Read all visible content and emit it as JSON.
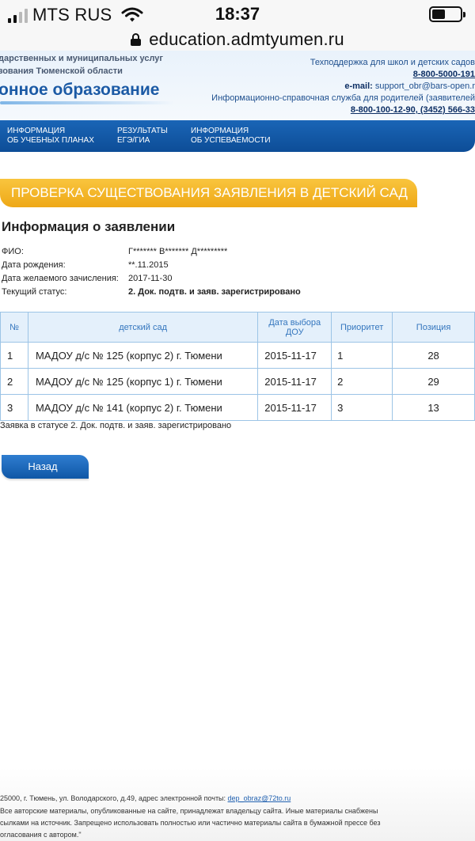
{
  "status_bar": {
    "carrier": "MTS RUS",
    "time": "18:37",
    "battery_level": 0.46
  },
  "browser": {
    "url": "education.admtyumen.ru"
  },
  "header": {
    "org_line1": "дарственных и муниципальных услуг",
    "org_line2": "зования Тюменской области",
    "brand": "онное образование",
    "support_label": "Техподдержка для школ и детских садов",
    "support_phone": "8-800-5000-191",
    "email_label": "e-mail:",
    "email_value": "support_obr@bars-open.r",
    "parents_info": "Информационно-справочная служба для родителей (заявителей",
    "parents_phones": "8-800-100-12-90, (3452) 566-33"
  },
  "nav": {
    "item1_line1": "ИНФОРМАЦИЯ",
    "item1_line2": "ОБ УЧЕБНЫХ ПЛАНАХ",
    "item2_line1": "РЕЗУЛЬТАТЫ",
    "item2_line2": "ЕГЭ/ГИА",
    "item3_line1": "ИНФОРМАЦИЯ",
    "item3_line2": "ОБ УСПЕВАЕМОСТИ"
  },
  "page": {
    "banner_title": "ПРОВЕРКА СУЩЕСТВОВАНИЯ ЗАЯВЛЕНИЯ В ДЕТСКИЙ САД",
    "info_title": "Информация о заявлении",
    "fio_label": "ФИО:",
    "fio_value": "Г******* В******* Д*********",
    "birth_label": "Дата рождения:",
    "birth_value": "**.11.2015",
    "enroll_label": "Дата желаемого зачисления:",
    "enroll_value": "2017-11-30",
    "status_label": "Текущий статус:",
    "status_value": "2. Док. подтв. и заяв. зарегистрировано",
    "status_note": "Заявка в статусе 2. Док. подтв. и заяв. зарегистрировано",
    "back_button": "Назад"
  },
  "table": {
    "headers": {
      "num": "№",
      "kindergarten": "детский сад",
      "date_line1": "Дата выбора",
      "date_line2": "ДОУ",
      "priority": "Приоритет",
      "position": "Позиция"
    },
    "rows": [
      {
        "num": "1",
        "kindergarten": "МАДОУ д/с № 125 (корпус 2) г. Тюмени",
        "date": "2015-11-17",
        "priority": "1",
        "position": "28"
      },
      {
        "num": "2",
        "kindergarten": "МАДОУ д/с № 125 (корпус 1) г. Тюмени",
        "date": "2015-11-17",
        "priority": "2",
        "position": "29"
      },
      {
        "num": "3",
        "kindergarten": "МАДОУ д/с № 141 (корпус 2) г. Тюмени",
        "date": "2015-11-17",
        "priority": "3",
        "position": "13"
      }
    ]
  },
  "footer": {
    "address": "25000, г. Тюмень, ул. Володарского, д.49, адрес электронной почты:",
    "email": "dep_obraz@72to.ru",
    "copyright_line1": "Все авторские материалы, опубликованные на сайте, принадлежат владельцу сайта. Иные материалы снабжены",
    "copyright_line2": "сылками на источник. Запрещено использовать полностью или частично материалы сайта в бумажной прессе без",
    "copyright_line3": "огласования с автором.\""
  },
  "icons": {
    "signal": "signal-bars-icon",
    "wifi": "wifi-icon",
    "battery": "battery-icon",
    "lock": "lock-icon"
  },
  "colors": {
    "nav_blue": "#1a65b6",
    "banner_orange": "#f3b52a",
    "header_text_blue": "#1b5aa5",
    "table_border": "#9cc4e6"
  }
}
